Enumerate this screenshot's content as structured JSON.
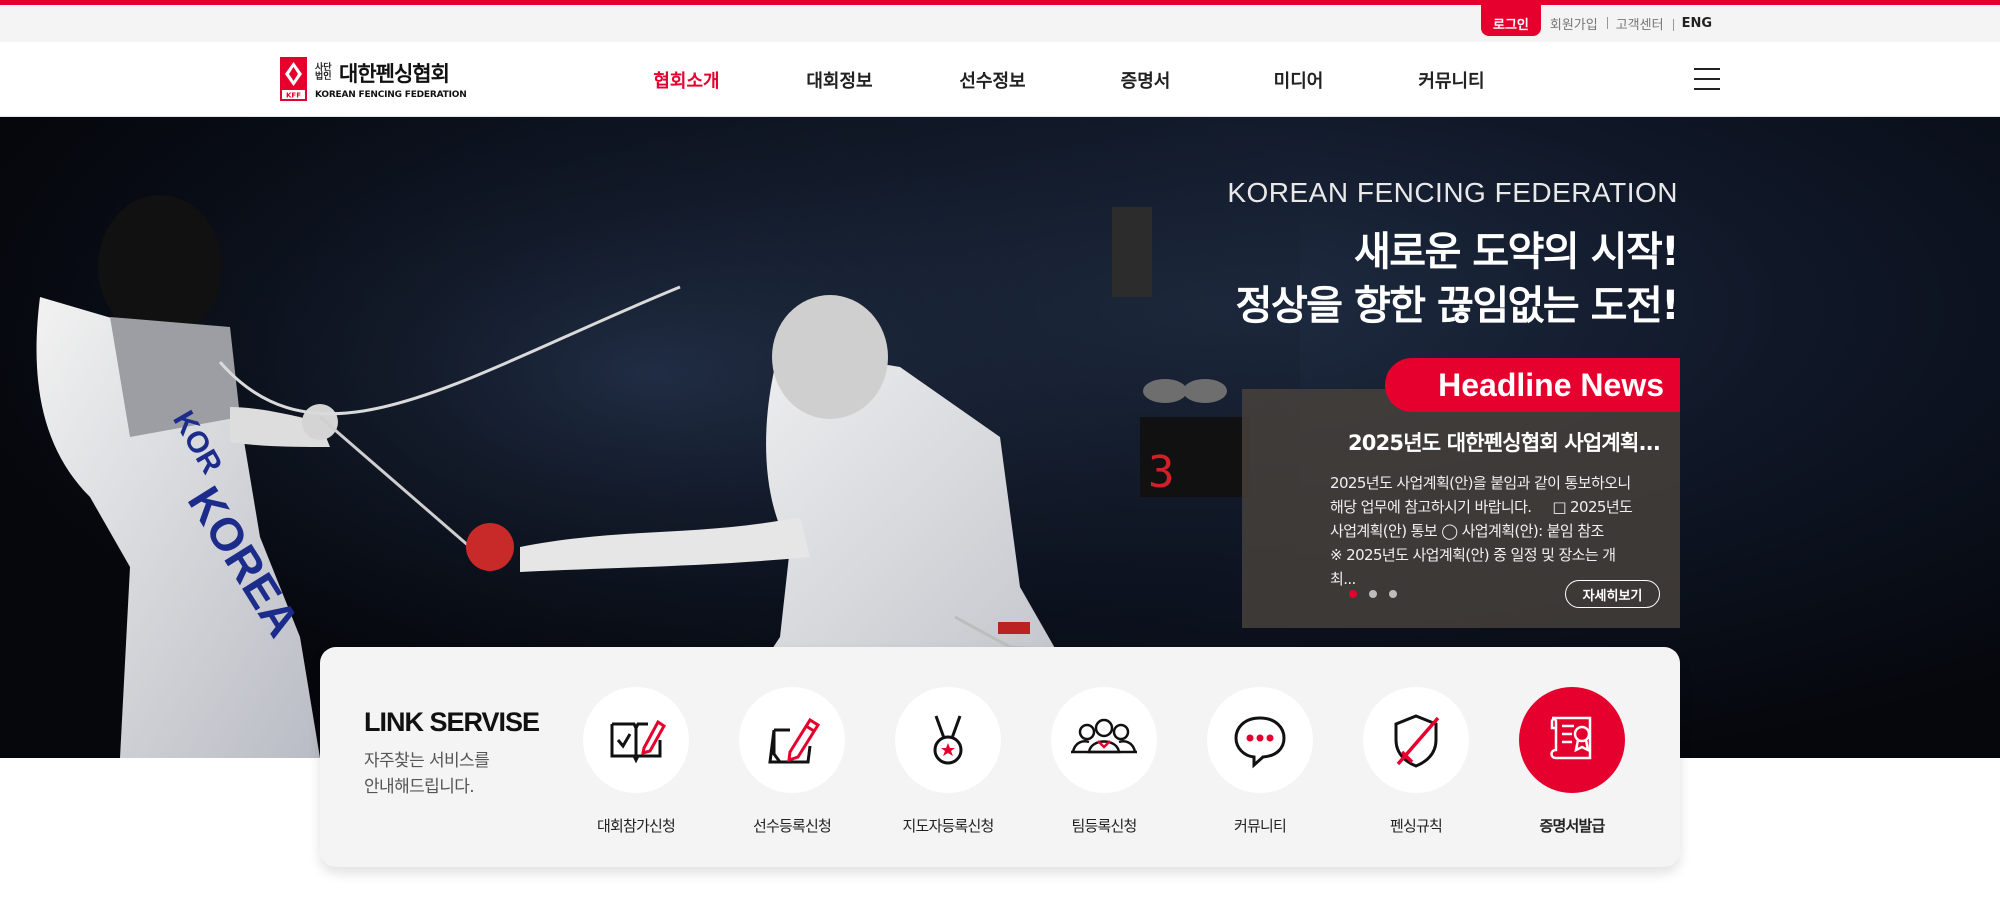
{
  "colors": {
    "accent": "#e6002d",
    "dark_text": "#222222",
    "panel_bg": "#f4f4f4"
  },
  "util_nav": {
    "login": "로그인",
    "signup": "회원가입",
    "support": "고객센터",
    "eng": "ENG"
  },
  "logo": {
    "mark_letters": "KFF",
    "prefix": "사단 법인",
    "name_kr": "대한펜싱협회",
    "name_en": "KOREAN FENCING FEDERATION"
  },
  "gnb": [
    {
      "label": "협회소개",
      "active": true
    },
    {
      "label": "대회정보",
      "active": false
    },
    {
      "label": "선수정보",
      "active": false
    },
    {
      "label": "증명서",
      "active": false
    },
    {
      "label": "미디어",
      "active": false
    },
    {
      "label": "커뮤니티",
      "active": false
    }
  ],
  "hero": {
    "eyebrow": "KOREAN FENCING FEDERATION",
    "title_line1": "새로운 도약의 시작!",
    "title_line2": "정상을 향한 끊임없는 도전!",
    "photo_text_left": "KOREA",
    "photo_text_sleeve": "KOR",
    "scoreboard": "3"
  },
  "headline": {
    "tab": "Headline News",
    "title": "2025년도 대한펜싱협회 사업계획...",
    "body_line1": "2025년도 사업계획(안)을 붙임과 같이 통보하오니",
    "body_line2": "해당 업무에 참고하시기 바랍니다.     □ 2025년도",
    "body_line3": "사업계획(안) 통보 ◯ 사업계획(안): 붙임 참조",
    "body_line4": "※ 2025년도 사업계획(안) 중 일정 및 장소는 개최...",
    "more": "자세히보기",
    "slide_count": 3,
    "active_slide": 1
  },
  "link_service": {
    "title": "LINK SERVISE",
    "desc_line1": "자주찾는 서비스를",
    "desc_line2": "안내해드립니다.",
    "items": [
      {
        "label": "대회참가신청",
        "icon": "checkbook-icon"
      },
      {
        "label": "선수등록신청",
        "icon": "pen-form-icon"
      },
      {
        "label": "지도자등록신청",
        "icon": "medal-icon"
      },
      {
        "label": "팀등록신청",
        "icon": "team-icon"
      },
      {
        "label": "커뮤니티",
        "icon": "chat-bubble-icon"
      },
      {
        "label": "펜싱규칙",
        "icon": "shield-sword-icon"
      },
      {
        "label": "증명서발급",
        "icon": "certificate-icon",
        "highlighted": true
      }
    ]
  }
}
